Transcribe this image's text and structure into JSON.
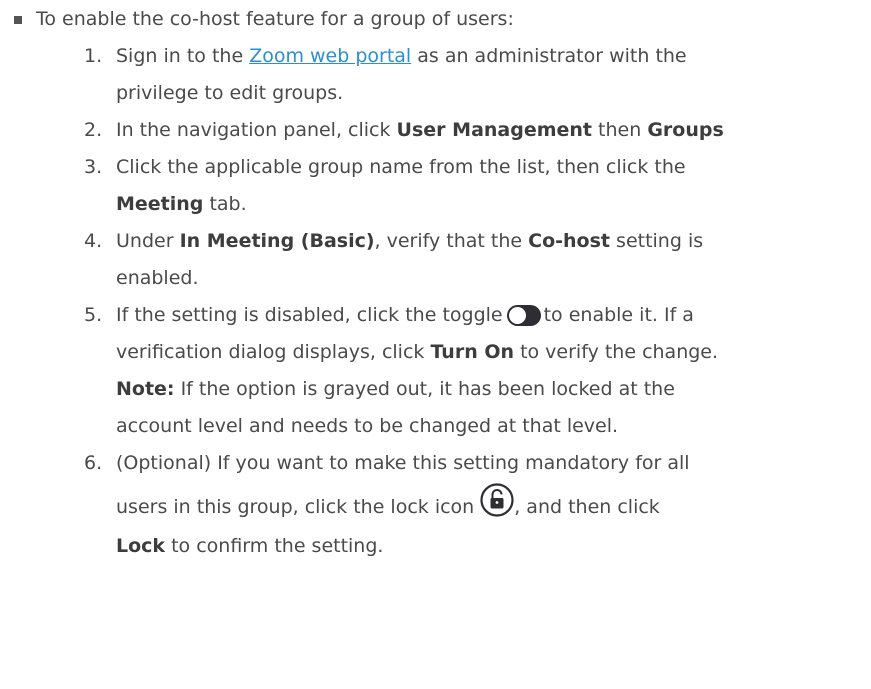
{
  "intro": "To enable the co-host feature for a group of users:",
  "steps": [
    {
      "num": "1.",
      "pre": "Sign in to the ",
      "link": "Zoom web portal",
      "post": " as an administrator with the",
      "line2": "privilege to edit groups."
    },
    {
      "num": "2.",
      "pre": "In the navigation panel, click ",
      "b1": "User Management",
      "mid": " then ",
      "b2": "Groups"
    },
    {
      "num": "3.",
      "text": "Click the applicable group name from the list, then click the",
      "b1": "Meeting",
      "post": " tab."
    },
    {
      "num": "4.",
      "pre": "Under ",
      "b1": "In Meeting (Basic)",
      "mid": ", verify that the ",
      "b2": "Co-host",
      "post": " setting is",
      "line2": "enabled."
    },
    {
      "num": "5.",
      "pre": "If the setting is disabled, click the toggle",
      "post": "to enable it. If a",
      "line2pre": "verification dialog displays, click ",
      "line2b": "Turn On",
      "line2post": " to verify the change.",
      "noteLabel": "Note:",
      "notePost": " If the option is grayed out,  it has been locked at the",
      "line4": "account level and needs to be changed at that level."
    },
    {
      "num": "6.",
      "text": "(Optional) If you want to make this setting mandatory for all",
      "line2pre": "users in this group, click the lock icon",
      "line2post": ", and then click",
      "b1": "Lock",
      "line3post": " to confirm the setting."
    }
  ],
  "icons": {
    "toggle": "toggle-off-icon",
    "lock": "unlock-icon"
  },
  "colors": {
    "text": "#4a4a4a",
    "link": "#2b8fd0",
    "toggle": "#2d2d33"
  }
}
